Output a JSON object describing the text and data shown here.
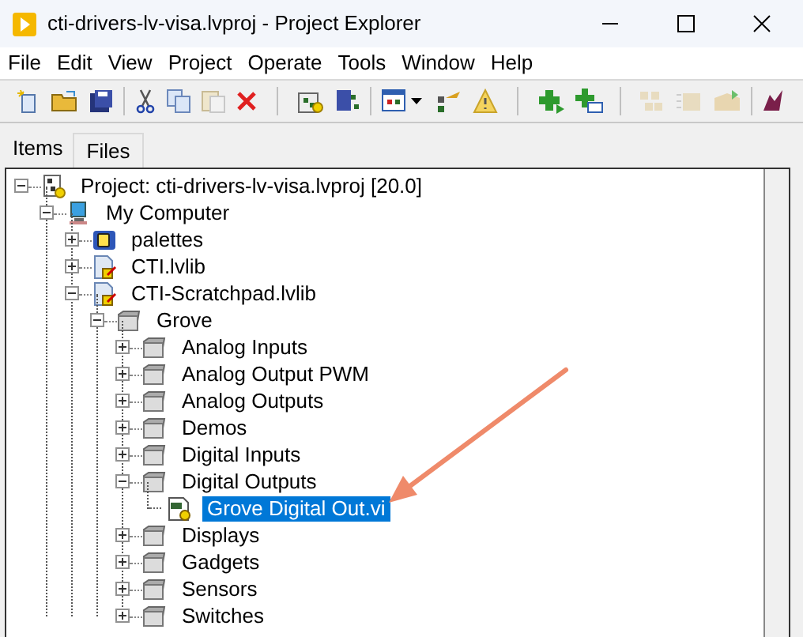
{
  "window": {
    "title": "cti-drivers-lv-visa.lvproj - Project Explorer"
  },
  "menu": [
    "File",
    "Edit",
    "View",
    "Project",
    "Operate",
    "Tools",
    "Window",
    "Help"
  ],
  "tabs": [
    {
      "label": "Items",
      "selected": true
    },
    {
      "label": "Files",
      "selected": false
    }
  ],
  "tree": [
    {
      "label": "Project: cti-drivers-lv-visa.lvproj [20.0]",
      "kind": "project",
      "expanded": true,
      "selected": false,
      "children": [
        {
          "label": "My Computer",
          "kind": "computer",
          "expanded": true,
          "selected": false,
          "children": [
            {
              "label": "palettes",
              "kind": "palette",
              "expanded": false,
              "selected": false
            },
            {
              "label": "CTI.lvlib",
              "kind": "library",
              "expanded": false,
              "selected": false
            },
            {
              "label": "CTI-Scratchpad.lvlib",
              "kind": "library",
              "expanded": true,
              "selected": false,
              "children": [
                {
                  "label": "Grove",
                  "kind": "folder",
                  "expanded": true,
                  "selected": false,
                  "children": [
                    {
                      "label": "Analog Inputs",
                      "kind": "folder",
                      "expanded": false,
                      "selected": false
                    },
                    {
                      "label": "Analog Output PWM",
                      "kind": "folder",
                      "expanded": false,
                      "selected": false
                    },
                    {
                      "label": "Analog Outputs",
                      "kind": "folder",
                      "expanded": false,
                      "selected": false
                    },
                    {
                      "label": "Demos",
                      "kind": "folder",
                      "expanded": false,
                      "selected": false
                    },
                    {
                      "label": "Digital Inputs",
                      "kind": "folder",
                      "expanded": false,
                      "selected": false
                    },
                    {
                      "label": "Digital Outputs",
                      "kind": "folder",
                      "expanded": true,
                      "selected": false,
                      "children": [
                        {
                          "label": "Grove Digital Out.vi",
                          "kind": "vi",
                          "selected": true
                        }
                      ]
                    },
                    {
                      "label": "Displays",
                      "kind": "folder",
                      "expanded": false,
                      "selected": false
                    },
                    {
                      "label": "Gadgets",
                      "kind": "folder",
                      "expanded": false,
                      "selected": false
                    },
                    {
                      "label": "Sensors",
                      "kind": "folder",
                      "expanded": false,
                      "selected": false
                    },
                    {
                      "label": "Switches",
                      "kind": "folder",
                      "expanded": false,
                      "selected": false
                    }
                  ]
                }
              ]
            }
          ]
        }
      ]
    }
  ]
}
